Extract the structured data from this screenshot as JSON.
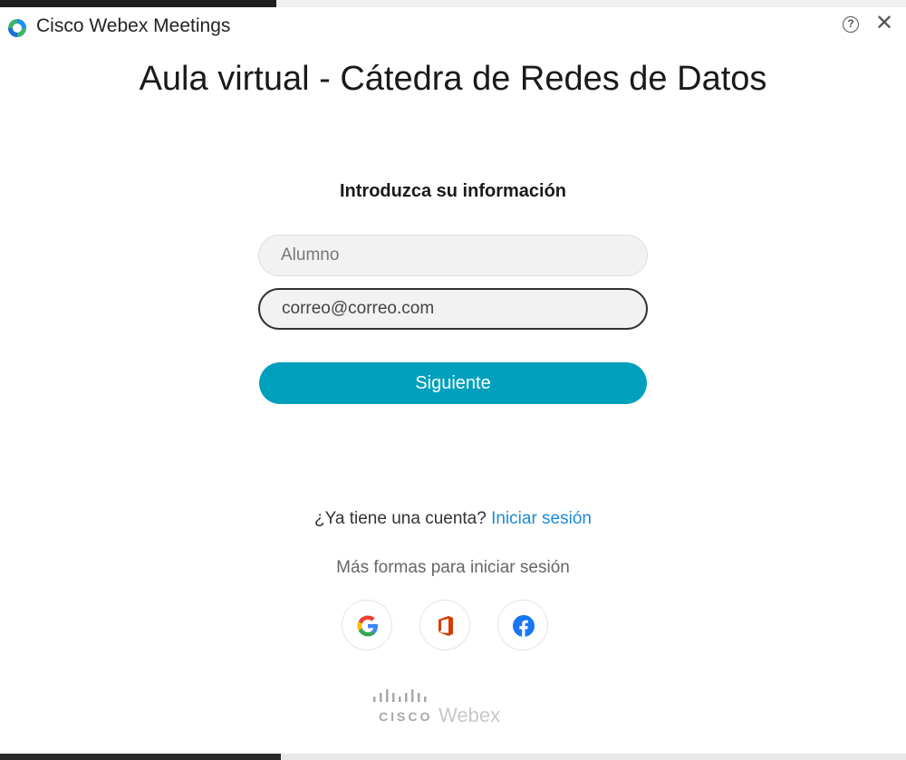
{
  "window": {
    "app_title": "Cisco Webex Meetings",
    "help_icon": "help-circle-icon",
    "close_icon": "close-icon"
  },
  "meeting": {
    "title": "Aula virtual - Cátedra de Redes de Datos"
  },
  "form": {
    "heading": "Introduzca su información",
    "name_value": "",
    "name_placeholder": "Alumno",
    "email_value": "correo@correo.com",
    "next_label": "Siguiente"
  },
  "signin": {
    "question": "¿Ya tiene una cuenta?",
    "link": "Iniciar sesión",
    "more_ways": "Más formas para iniciar sesión",
    "providers": [
      "google-icon",
      "office-icon",
      "facebook-icon"
    ]
  },
  "brand": {
    "cisco": "CISCO",
    "product": "Webex"
  },
  "colors": {
    "accent": "#00a0bd",
    "link": "#1a8bd8"
  }
}
